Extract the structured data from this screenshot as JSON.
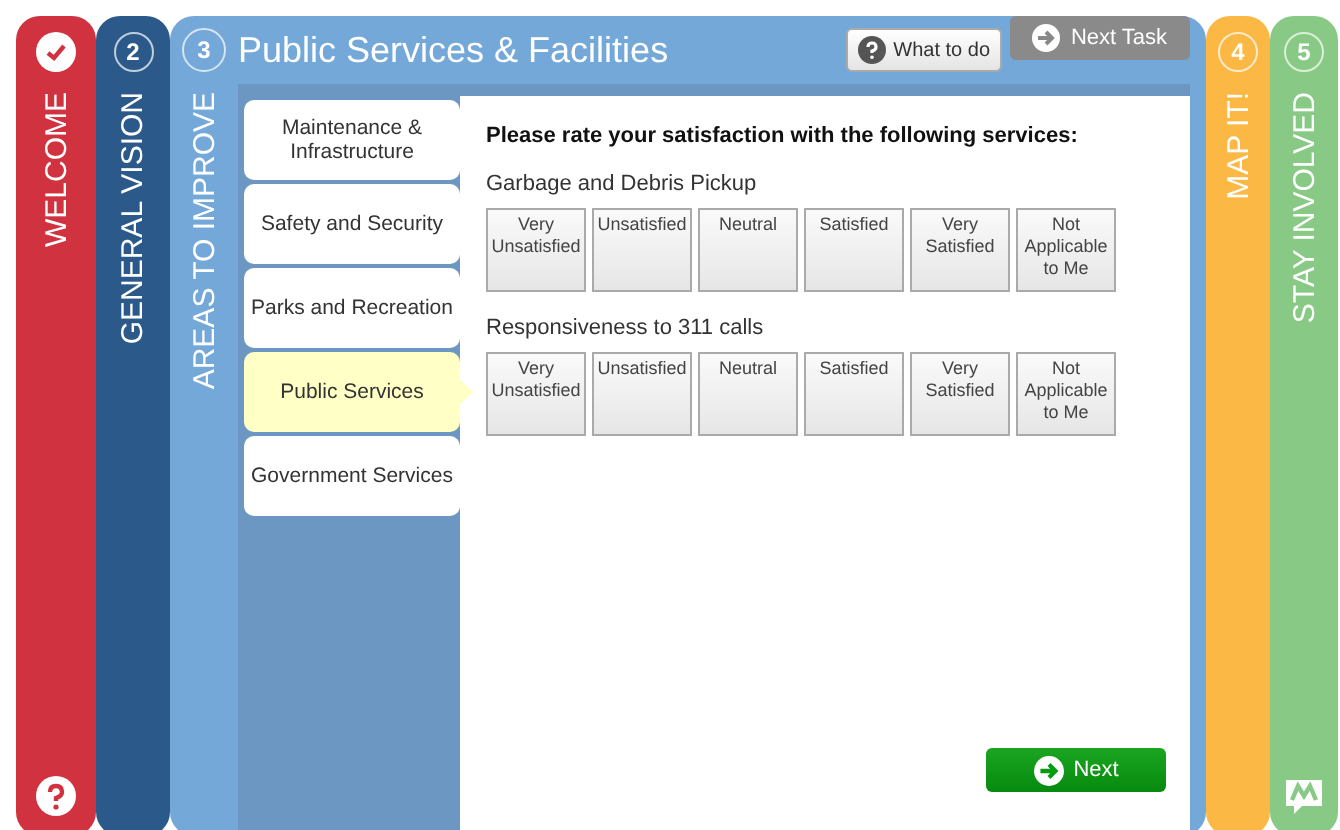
{
  "left_stages": [
    {
      "kind": "done",
      "label": "WELCOME",
      "color": "#d0323f"
    },
    {
      "kind": "number",
      "number": "2",
      "label": "GENERAL VISION",
      "color": "#2b5a8a"
    }
  ],
  "current_stage": {
    "number": "3",
    "label": "AREAS TO IMPROVE",
    "title": "Public Services & Facilities",
    "buttons": [
      {
        "kind": "help",
        "label": "What to do"
      },
      {
        "kind": "next",
        "label": "Next Task"
      }
    ]
  },
  "categories": [
    {
      "label": "Maintenance & Infrastructure",
      "selected": false
    },
    {
      "label": "Safety and Security",
      "selected": false
    },
    {
      "label": "Parks and Recreation",
      "selected": false
    },
    {
      "label": "Public Services",
      "selected": true
    },
    {
      "label": "Government Services",
      "selected": false
    }
  ],
  "prompt": "Please rate your satisfaction with the following services:",
  "questions": [
    {
      "label": "Garbage and Debris Pickup",
      "options": [
        {
          "label": "Very Unsatisfied",
          "selected": false
        },
        {
          "label": "Unsatisfied",
          "selected": false
        },
        {
          "label": "Neutral",
          "selected": false
        },
        {
          "label": "Satisfied",
          "selected": false
        },
        {
          "label": "Very Satisfied",
          "selected": false
        },
        {
          "label": "Not Applicable to Me",
          "selected": false
        }
      ]
    },
    {
      "label": "Responsiveness to 311 calls",
      "options": [
        {
          "label": "Very Unsatisfied",
          "selected": false
        },
        {
          "label": "Unsatisfied",
          "selected": false
        },
        {
          "label": "Neutral",
          "selected": false
        },
        {
          "label": "Satisfied",
          "selected": false
        },
        {
          "label": "Very Satisfied",
          "selected": false
        },
        {
          "label": "Not Applicable to Me",
          "selected": false
        }
      ]
    }
  ],
  "next_button": "Next",
  "right_stages": [
    {
      "kind": "number",
      "number": "4",
      "label": "MAP IT!",
      "color": "#fbb845"
    },
    {
      "kind": "number",
      "number": "5",
      "label": "STAY INVOLVED",
      "color": "#88c985"
    }
  ]
}
